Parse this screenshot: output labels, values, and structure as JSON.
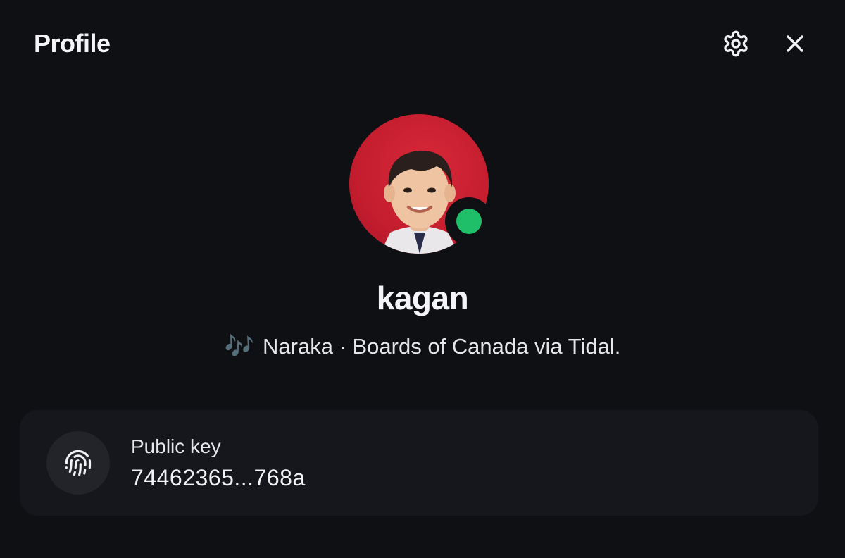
{
  "header": {
    "title": "Profile",
    "settings_icon": "gear-icon",
    "close_icon": "close-icon"
  },
  "profile": {
    "username": "kagan",
    "status": "online",
    "status_color": "#1fbf6a",
    "avatar_bg": "#c41d2e"
  },
  "now_playing": {
    "icon": "music-notes-icon",
    "glyph": "🎶",
    "text": "Naraka · Boards of Canada via Tidal."
  },
  "public_key": {
    "icon": "fingerprint-icon",
    "label": "Public key",
    "value": "74462365...768a"
  }
}
